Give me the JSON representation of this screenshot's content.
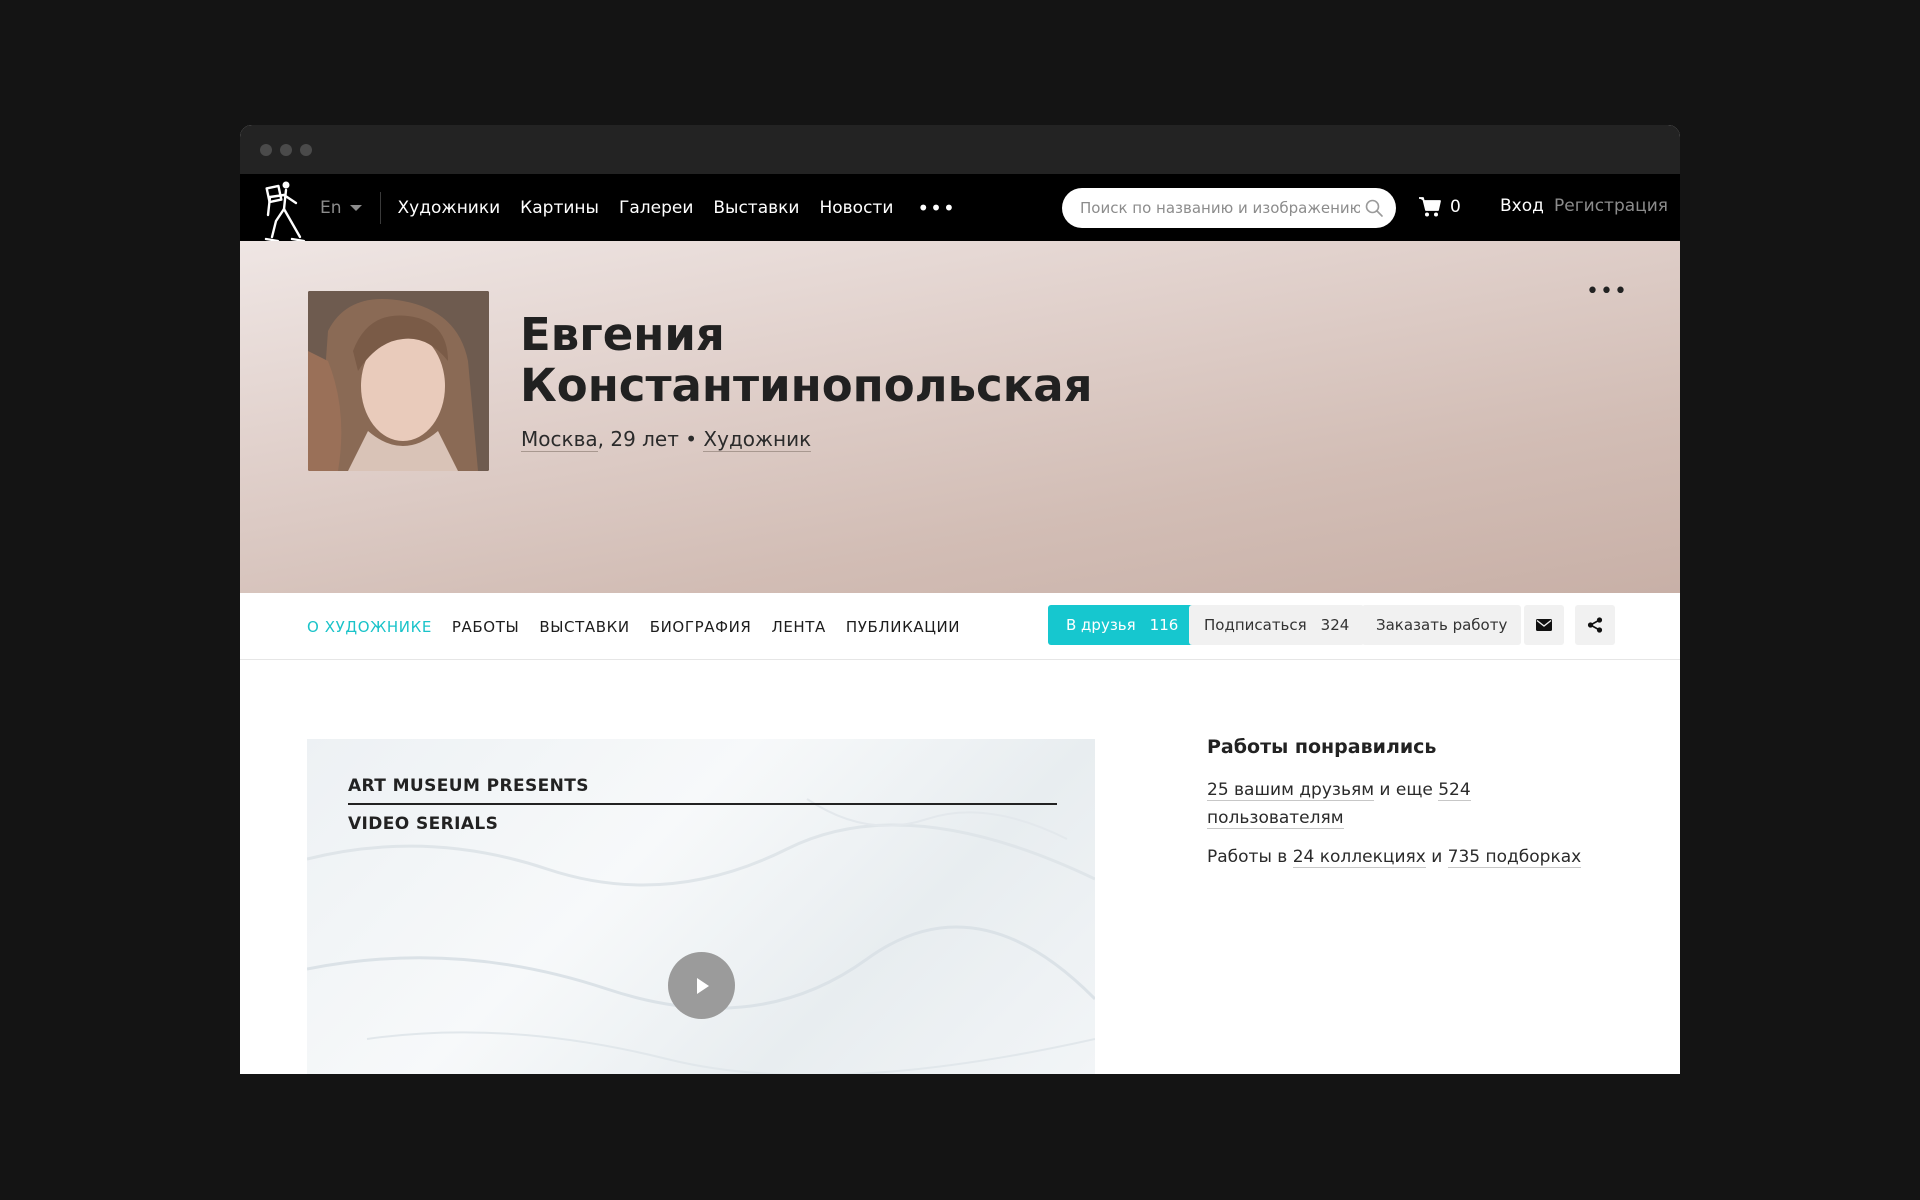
{
  "nav": {
    "language": "En",
    "links": [
      "Художники",
      "Картины",
      "Галереи",
      "Выставки",
      "Новости"
    ],
    "more": "•••",
    "search_placeholder": "Поиск по названию и изображению",
    "cart_count": "0",
    "login": "Вход",
    "register": "Регистрация"
  },
  "profile": {
    "name_line1": "Евгения",
    "name_line2": "Константинопольская",
    "city": "Москва",
    "age": "29 лет",
    "separator": " • ",
    "role": "Художник",
    "more": "•••"
  },
  "tabs": [
    "О ХУДОЖНИКЕ",
    "РАБОТЫ",
    "ВЫСТАВКИ",
    "БИОГРАФИЯ",
    "ЛЕНТА",
    "ПУБЛИКАЦИИ"
  ],
  "actions": {
    "friends_label": "В друзья",
    "friends_count": "116",
    "subscribe_label": "Подписаться",
    "subscribe_count": "324",
    "order_label": "Заказать работу"
  },
  "video": {
    "line1": "ART MUSEUM PRESENTS",
    "line2": "VIDEO SERIALS"
  },
  "aside": {
    "title": "Работы понравились",
    "friends_link": "25 вашим друзьям",
    "and_more": " и еще ",
    "users_link_a": "524",
    "users_link_b": "пользователям",
    "collections_prefix": "Работы в ",
    "collections_link": "24 коллекциях",
    "and": " и ",
    "selections_link": "735 подборках"
  },
  "colors": {
    "accent": "#16c7cf",
    "nav_bg": "#000000",
    "page_bg": "#141414"
  }
}
